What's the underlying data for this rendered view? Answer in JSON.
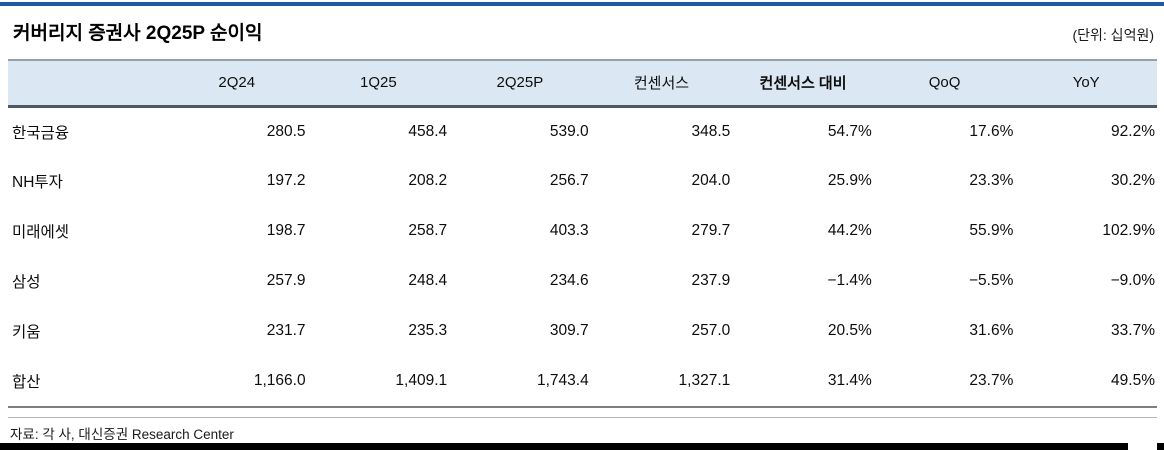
{
  "report": {
    "title": "커버리지 증권사 2Q25P 순이익",
    "unit": "(단위: 십억원)",
    "source": "자료: 각 사, 대신증권 Research Center"
  },
  "table": {
    "columns": [
      "",
      "2Q24",
      "1Q25",
      "2Q25P",
      "컨센서스",
      "컨센서스 대비",
      "QoQ",
      "YoY"
    ],
    "rows": [
      {
        "name": "한국금융",
        "values": [
          "280.5",
          "458.4",
          "539.0",
          "348.5",
          "54.7%",
          "17.6%",
          "92.2%"
        ]
      },
      {
        "name": "NH투자",
        "values": [
          "197.2",
          "208.2",
          "256.7",
          "204.0",
          "25.9%",
          "23.3%",
          "30.2%"
        ]
      },
      {
        "name": "미래에셋",
        "values": [
          "198.7",
          "258.7",
          "403.3",
          "279.7",
          "44.2%",
          "55.9%",
          "102.9%"
        ]
      },
      {
        "name": "삼성",
        "values": [
          "257.9",
          "248.4",
          "234.6",
          "237.9",
          "−1.4%",
          "−5.5%",
          "−9.0%"
        ]
      },
      {
        "name": "키움",
        "values": [
          "231.7",
          "235.3",
          "309.7",
          "257.0",
          "20.5%",
          "31.6%",
          "33.7%"
        ]
      },
      {
        "name": "합산",
        "values": [
          "1,166.0",
          "1,409.1",
          "1,743.4",
          "1,327.1",
          "31.4%",
          "23.7%",
          "49.5%"
        ]
      }
    ]
  },
  "colors": {
    "accent_blue": "#1d5ba6",
    "header_band_bg": "#dbe7f3",
    "header_top_border": "#97a0aa",
    "header_bottom_border": "#4f5761",
    "table_bottom_rule": "#7e7e7e",
    "footer_rule": "#b3b3b3",
    "bottom_bar": "#000000"
  }
}
